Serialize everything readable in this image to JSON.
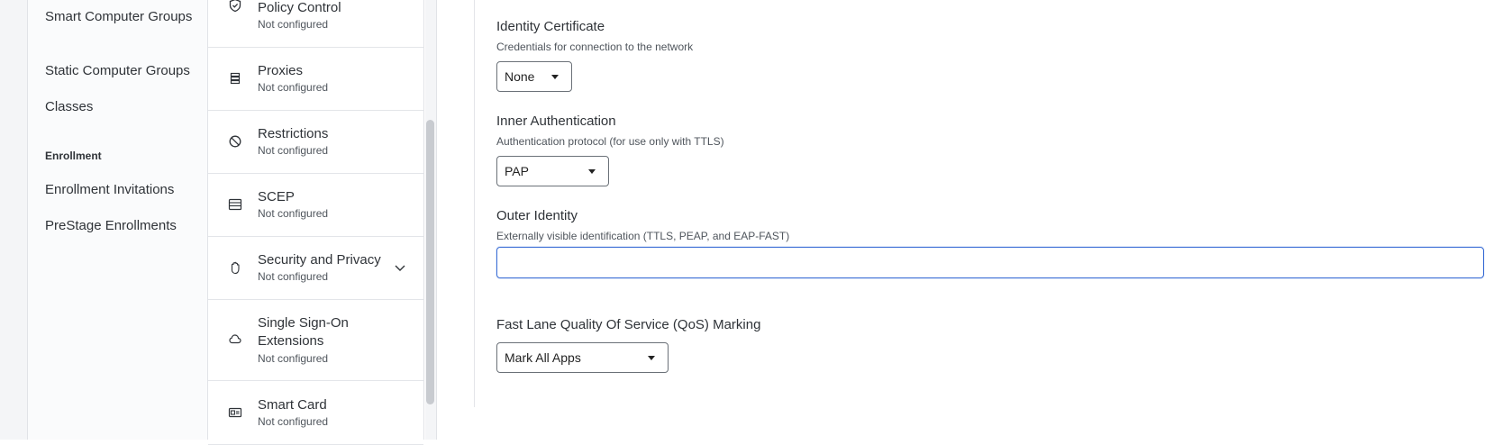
{
  "sidebar": {
    "items": [
      {
        "label": "Smart Computer Groups"
      },
      {
        "label": "Static Computer Groups"
      },
      {
        "label": "Classes"
      }
    ],
    "enrollment_heading": "Enrollment",
    "enrollment_items": [
      {
        "label": "Enrollment Invitations"
      },
      {
        "label": "PreStage Enrollments"
      }
    ]
  },
  "payloads": [
    {
      "title": "Policy Control",
      "status": "Not configured",
      "icon": "shield-check-icon"
    },
    {
      "title": "Proxies",
      "status": "Not configured",
      "icon": "server-stack-icon"
    },
    {
      "title": "Restrictions",
      "status": "Not configured",
      "icon": "prohibited-icon"
    },
    {
      "title": "SCEP",
      "status": "Not configured",
      "icon": "list-table-icon"
    },
    {
      "title": "Security and Privacy",
      "status": "Not configured",
      "icon": "hand-icon"
    },
    {
      "title": "Single Sign-On Extensions",
      "status": "Not configured",
      "icon": "cloud-icon"
    },
    {
      "title": "Smart Card",
      "status": "Not configured",
      "icon": "smart-card-icon"
    }
  ],
  "form": {
    "identity_certificate": {
      "label": "Identity Certificate",
      "help": "Credentials for connection to the network",
      "value": "None"
    },
    "inner_authentication": {
      "label": "Inner Authentication",
      "help": "Authentication protocol (for use only with TTLS)",
      "value": "PAP"
    },
    "outer_identity": {
      "label": "Outer Identity",
      "help": "Externally visible identification (TTLS, PEAP, and EAP-FAST)",
      "value": ""
    },
    "fast_lane_qos": {
      "label": "Fast Lane Quality Of Service (QoS) Marking",
      "value": "Mark All Apps"
    }
  },
  "colors": {
    "focus_border": "#3d6fd6",
    "nav_background": "#fafbfc"
  }
}
